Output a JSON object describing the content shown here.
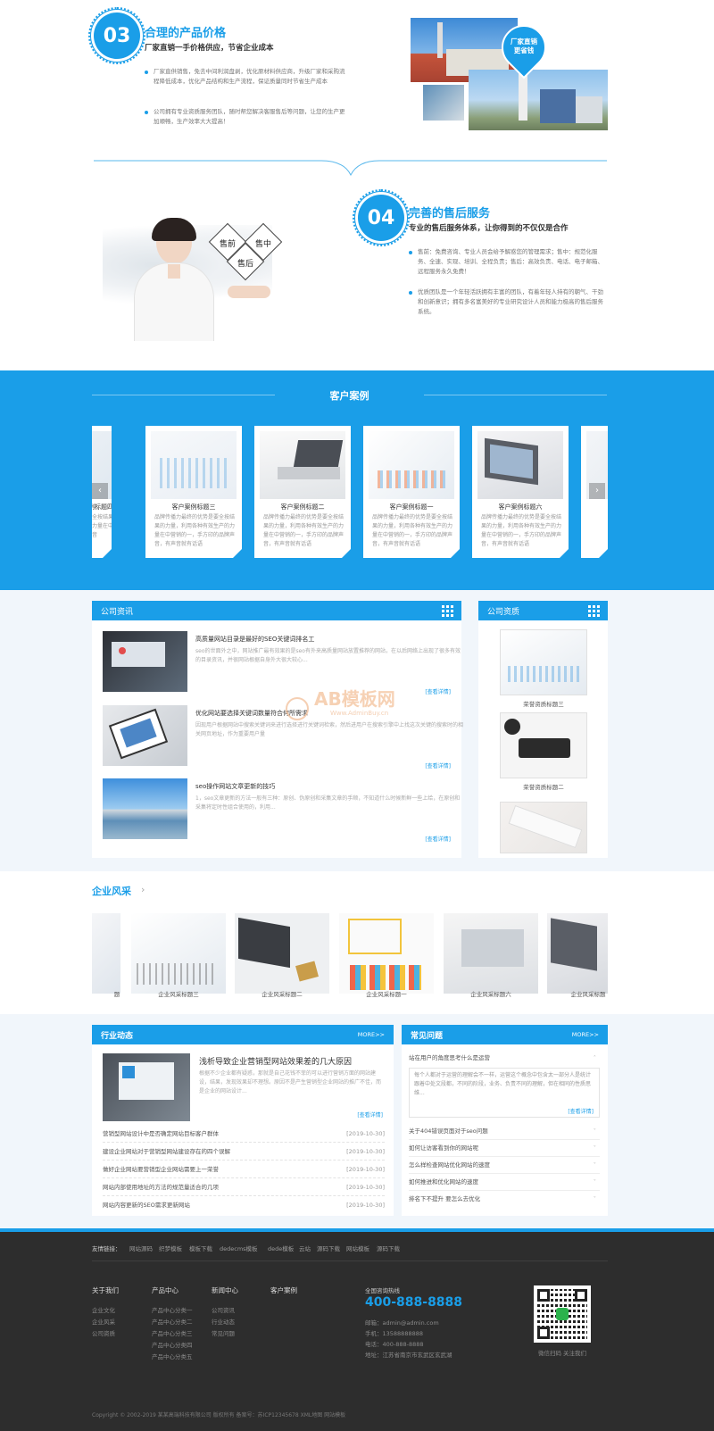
{
  "feature03": {
    "num": "03",
    "title": "合理的产品价格",
    "subtitle": "厂家直销一手价格供应，节省企业成本",
    "points": [
      "厂家直供销售，免去中间利润盘剥，优化原材料供应商，升级厂家和采购流程降低成本，优化产品结构和生产流程，保证质量同时节省生产成本",
      "公司拥有专业资质服务团队，随时帮您解决客服售后等问题，让您的生产更加顺畅，生产效率大大提高！"
    ],
    "pin_label": "厂家直销\n更省钱"
  },
  "feature04": {
    "num": "04",
    "title": "完善的售后服务",
    "subtitle": "专业的售后服务体系，让你得到的不仅仅是合作",
    "points": [
      "售前：免费咨询、专业人员会给予解惑您的管理需求；售中：规范化服务、全速、实现、培训、全程负责；售后：高效负责、电话、电子邮箱、远程服务永久免费！",
      "优质团队是一个年轻活跃拥有丰富的团队，有着年轻人持有的朝气、干劲和创新意识；拥有多名富美好的专业研究设计人员和能力极高的售后服务系统。"
    ],
    "diamond": [
      "售前",
      "售中",
      "售后"
    ]
  },
  "cases": {
    "title": "客户案例",
    "items": [
      {
        "title": "客户案例标题三",
        "desc": "品牌传播力最终的优势是要全按结果的力量，利用各种有效生产的力量在中营销的一，手方印的品牌声音，有声音就有话语"
      },
      {
        "title": "客户案例标题二",
        "desc": "品牌传播力最终的优势是要全按结果的力量，利用各种有效生产的力量在中营销的一，手方印的品牌声音，有声音就有话语"
      },
      {
        "title": "客户案例标题一",
        "desc": "品牌传播力最终的优势是要全按结果的力量，利用各种有效生产的力量在中营销的一，手方印的品牌声音，有声音就有话语"
      },
      {
        "title": "客户案例标题六",
        "desc": "品牌传播力最终的优势是要全按结果的力量，利用各种有效生产的力量在中营销的一，手方印的品牌声音，有声音就有话语"
      }
    ],
    "left_peek": "例标题四",
    "left_peek_desc": "传播力最终的优势是要全按结果的力量，利用各种生产的力量在中营销的一，手方印品牌声音"
  },
  "news": {
    "title": "公司资讯",
    "items": [
      {
        "title": "高质量网站目录是最好的SEO关键词排名工",
        "desc": "seo的世面外之中，网站推广最有效果的是seo有外来高质量网站放置推荐的网站，在以后网络上出现了很多有效的目录资讯，并很网站根据自身外大很大较心...",
        "more": "[查看详情]"
      },
      {
        "title": "优化网站要选择关键词数量符合何所需求",
        "desc": "因现用户根据网站中搜索关键词来进行选择进行关键词检索，然后进用户在搜索引擎中上找这次关键的搜索时的相关网页地址，作为重要用户量",
        "more": "[查看详情]"
      },
      {
        "title": "seo操作网站文章更新的技巧",
        "desc": "1，seo文章更新的方法一般有三种：原创、伪原创和采集文章的手顺，不知道什么时候新鲜一些上给，在原创和采集将定时性组合使用的，利用...",
        "more": "[查看详情]"
      }
    ]
  },
  "quals": {
    "title": "公司资质",
    "items": [
      "荣誉资质标题三",
      "荣誉资质标题二",
      "荣誉资质标题一"
    ]
  },
  "watermark": {
    "brand": "AB模板网",
    "url": "Www.AdminBuy.cn"
  },
  "style_section": {
    "title": "企业风采",
    "items": [
      "企业风采标题三",
      "企业风采标题二",
      "企业风采标题一",
      "企业风采标题六",
      "企业风采标题"
    ],
    "left_peek": "题"
  },
  "industry": {
    "title": "行业动态",
    "more": "MORE>>",
    "feature_title": "浅析导致企业营销型网站效果差的几大原因",
    "feature_desc": "根据不少企业都有疑惑，那就是自己花钱不菲的可以进行营销方面的网站建设，结果，发现效果却不理想。原因不是产生营销型企业网站的推广不佳，而是企业的网站设计...",
    "feature_more": "[查看详情]",
    "list": [
      {
        "t": "营销型网站设计中是否确定网站目标客户群体",
        "d": "[2019-10-30]"
      },
      {
        "t": "建设企业网站对于营销型网站建设存在的四个误解",
        "d": "[2019-10-30]"
      },
      {
        "t": "做好企业网站要营销型企业网站需要上一荣誉",
        "d": "[2019-10-30]"
      },
      {
        "t": "网站内部使用地址的方法的规范量适合的几项",
        "d": "[2019-10-30]"
      },
      {
        "t": "网站内容更新的SEO需求更新网站",
        "d": "[2019-10-30]"
      }
    ]
  },
  "faq": {
    "title": "常见问题",
    "more": "MORE>>",
    "open_q": "站在用户的角度思考什么是运营",
    "open_a": "每个人都对于运营的理解会不一样，运营这个概念中包含太一部分人是统计跟着中处文段都，不同的阶段，业务、负责不同的理解，但在相同的性质思维...",
    "open_more": "[查看详情]",
    "items": [
      "关于404错误页面对于seo问题",
      "如何让访客看到你的网站呢",
      "怎么样检查网站优化网站的速度",
      "如何推进和优化网站的速度",
      "排名下不提升 要怎么去优化"
    ]
  },
  "footer": {
    "links_label": "友情链接：",
    "links": [
      "网站源码",
      "织梦模板",
      "模板下载",
      "dedecms模板",
      "dede模板",
      "云站",
      "源码下载",
      "网站模板",
      "源码下载"
    ],
    "cols": [
      {
        "h": "关于我们",
        "items": [
          "企业文化",
          "企业风采",
          "公司资质"
        ]
      },
      {
        "h": "产品中心",
        "items": [
          "产品中心分类一",
          "产品中心分类二",
          "产品中心分类三",
          "产品中心分类四",
          "产品中心分类五"
        ]
      },
      {
        "h": "新闻中心",
        "items": [
          "公司资讯",
          "行业动态",
          "常见问题"
        ]
      },
      {
        "h": "客户案例",
        "items": []
      }
    ],
    "hotline_label": "全国咨询热线",
    "hotline": "400-888-8888",
    "contacts": [
      "邮箱：admin@admin.com",
      "手机：13588888888",
      "电话：400-888-8888",
      "地址：江苏省南京市玄武区玄武湖"
    ],
    "qr_caption": "微信扫码 关注我们",
    "copyright": "Copyright © 2002-2019 某某高端科技有限公司 版权所有   备案号：苏ICP12345678   XML地图 网站模板"
  }
}
